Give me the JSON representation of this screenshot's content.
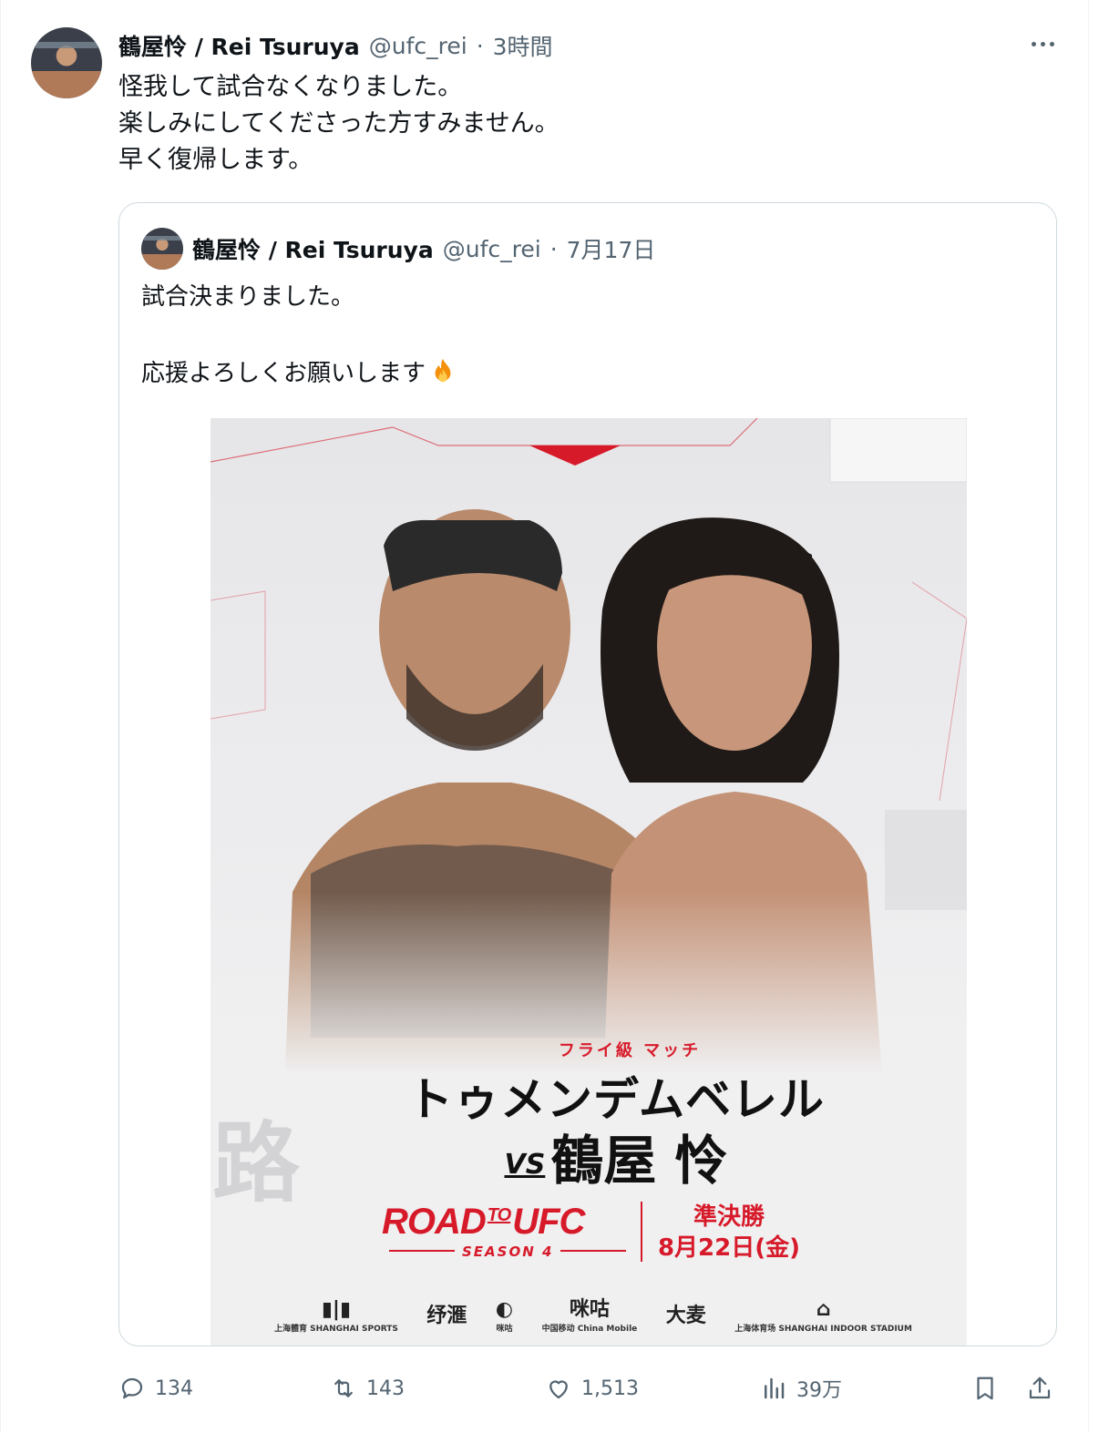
{
  "tweet": {
    "display_name": "鶴屋怜 / Rei Tsuruya",
    "handle": "@ufc_rei",
    "separator": "·",
    "time": "3時間",
    "text": "怪我して試合なくなりました。\n楽しみにしてくださった方すみません。\n早く復帰します。"
  },
  "quoted_tweet": {
    "display_name": "鶴屋怜 / Rei Tsuruya",
    "handle": "@ufc_rei",
    "separator": "·",
    "date": "7月17日",
    "text": "試合決まりました。\n\n応援よろしくお願いします",
    "emoji": "fire-emoji",
    "poster": {
      "weight_class": "フライ級 マッチ",
      "fighter_1": "トゥメンデムベレル",
      "vs": "VS",
      "fighter_2": "鶴屋 怜",
      "event_road": "ROAD",
      "event_to": "TO",
      "event_ufc": "UFC",
      "season": "SEASON 4",
      "round": "準決勝",
      "date": "8月22日(金)",
      "bg_char": "路",
      "sponsors": [
        {
          "mark": "▮|▮",
          "label": "上海體育 SHANGHAI SPORTS"
        },
        {
          "mark": "纾滙",
          "label": ""
        },
        {
          "mark": "◐",
          "label": "咪咕"
        },
        {
          "mark": "咪咕",
          "label": "中国移动 China Mobile"
        },
        {
          "mark": "大麦",
          "label": ""
        },
        {
          "mark": "⌂",
          "label": "上海体育场 SHANGHAI INDOOR STADIUM"
        }
      ]
    }
  },
  "actions": {
    "replies": "134",
    "retweets": "143",
    "likes": "1,513",
    "views": "39万"
  },
  "colors": {
    "text": "#0f1419",
    "muted": "#536471",
    "border": "#cfd9de",
    "accent_red": "#d71a2a"
  }
}
